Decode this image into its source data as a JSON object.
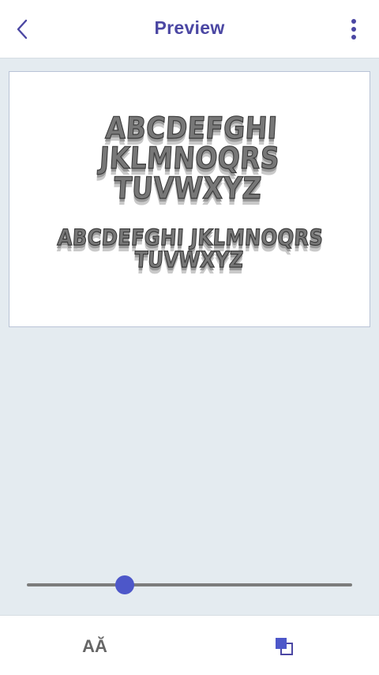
{
  "header": {
    "title": "Preview",
    "back_icon": "chevron-left-icon",
    "menu_icon": "more-vertical-icon"
  },
  "preview": {
    "large_line1": "ABCDEFGHI JKLMNOQRS",
    "large_line2": "TUVWXYZ",
    "small_line1": "ABCDEFGHI JKLMNOQRS",
    "small_line2": "TUVWXYZ"
  },
  "size_slider": {
    "value": 0.3
  },
  "bottom_bar": {
    "font_button_label": "AĂ",
    "color_icon": "color-swap-icon"
  },
  "colors": {
    "accent": "#4b47a3",
    "thumb": "#4d57c9",
    "background": "#e4ebf0"
  }
}
